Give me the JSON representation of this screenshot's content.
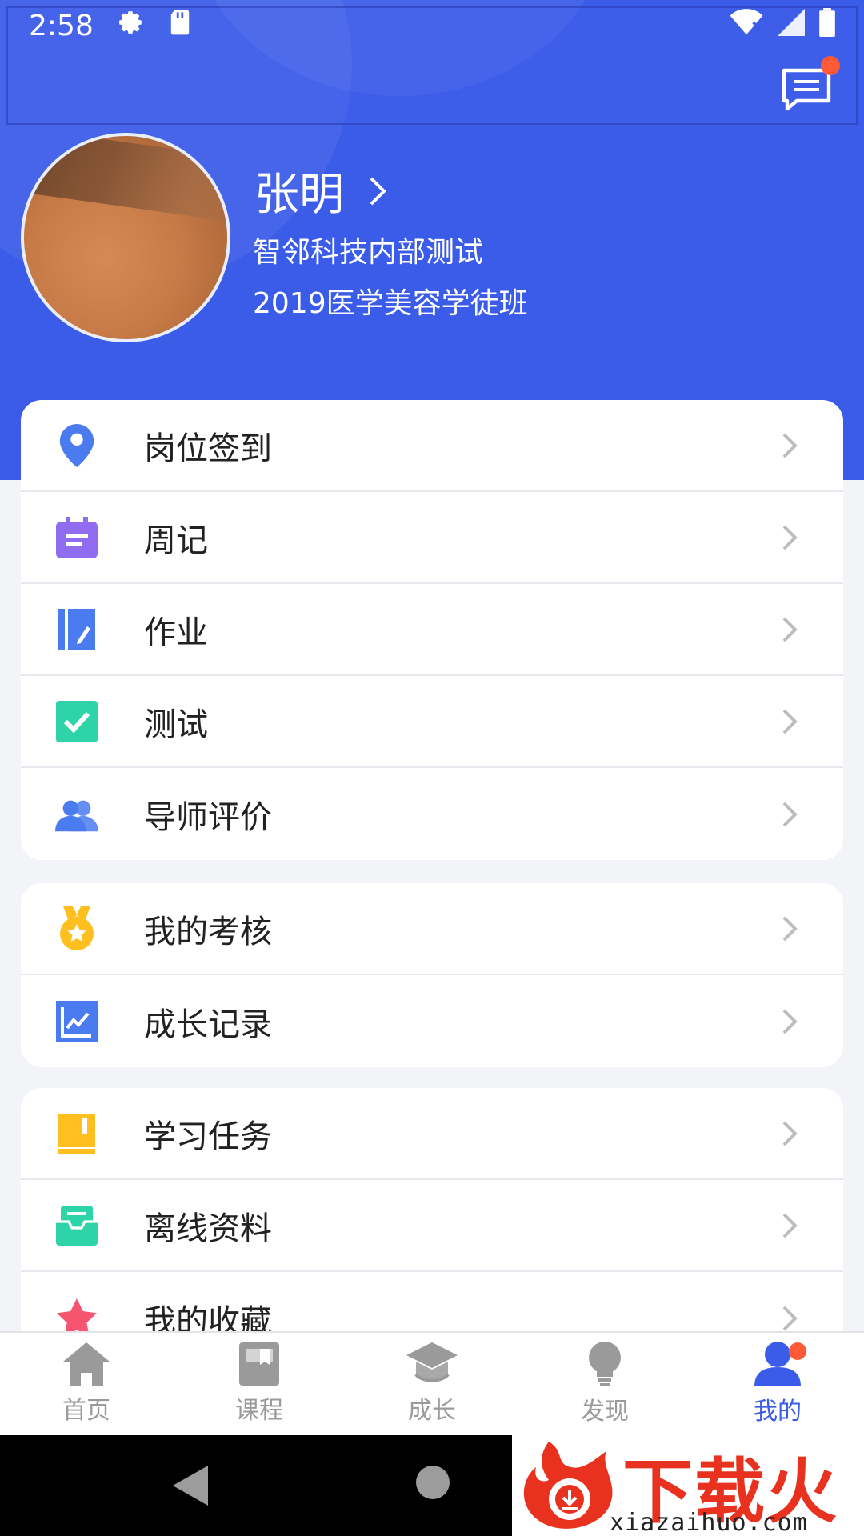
{
  "status_bar": {
    "time": "2:58"
  },
  "profile": {
    "name": "张明",
    "line1": "智邻科技内部测试",
    "line2": "2019医学美容学徒班"
  },
  "menu_group1": [
    {
      "label": "岗位签到",
      "icon": "location-pin-icon"
    },
    {
      "label": "周记",
      "icon": "calendar-note-icon"
    },
    {
      "label": "作业",
      "icon": "notebook-pen-icon"
    },
    {
      "label": "测试",
      "icon": "checkbox-icon"
    },
    {
      "label": "导师评价",
      "icon": "users-icon"
    }
  ],
  "menu_group2": [
    {
      "label": "我的考核",
      "icon": "medal-icon"
    },
    {
      "label": "成长记录",
      "icon": "chart-line-icon"
    }
  ],
  "menu_group3": [
    {
      "label": "学习任务",
      "icon": "book-icon"
    },
    {
      "label": "离线资料",
      "icon": "tray-icon"
    },
    {
      "label": "我的收藏",
      "icon": "star-icon"
    }
  ],
  "bottom_nav": [
    {
      "label": "首页",
      "icon": "home-icon"
    },
    {
      "label": "课程",
      "icon": "course-book-icon"
    },
    {
      "label": "成长",
      "icon": "graduation-cap-icon"
    },
    {
      "label": "发现",
      "icon": "lightbulb-icon"
    },
    {
      "label": "我的",
      "icon": "user-icon",
      "active": true
    }
  ],
  "watermark": {
    "title": "下载火",
    "url": "xiazaihuo.com"
  },
  "colors": {
    "brand_blue": "#3b5ce8",
    "badge_red": "#ff5a36",
    "inactive_gray": "#9a9a9a"
  }
}
